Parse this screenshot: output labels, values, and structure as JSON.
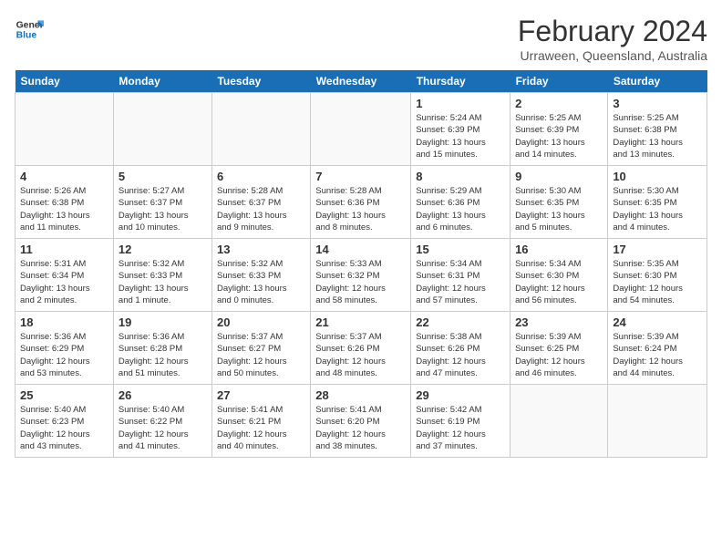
{
  "header": {
    "logo_general": "General",
    "logo_blue": "Blue",
    "month": "February 2024",
    "location": "Urraween, Queensland, Australia"
  },
  "days_of_week": [
    "Sunday",
    "Monday",
    "Tuesday",
    "Wednesday",
    "Thursday",
    "Friday",
    "Saturday"
  ],
  "weeks": [
    [
      {
        "num": "",
        "detail": ""
      },
      {
        "num": "",
        "detail": ""
      },
      {
        "num": "",
        "detail": ""
      },
      {
        "num": "",
        "detail": ""
      },
      {
        "num": "1",
        "detail": "Sunrise: 5:24 AM\nSunset: 6:39 PM\nDaylight: 13 hours\nand 15 minutes."
      },
      {
        "num": "2",
        "detail": "Sunrise: 5:25 AM\nSunset: 6:39 PM\nDaylight: 13 hours\nand 14 minutes."
      },
      {
        "num": "3",
        "detail": "Sunrise: 5:25 AM\nSunset: 6:38 PM\nDaylight: 13 hours\nand 13 minutes."
      }
    ],
    [
      {
        "num": "4",
        "detail": "Sunrise: 5:26 AM\nSunset: 6:38 PM\nDaylight: 13 hours\nand 11 minutes."
      },
      {
        "num": "5",
        "detail": "Sunrise: 5:27 AM\nSunset: 6:37 PM\nDaylight: 13 hours\nand 10 minutes."
      },
      {
        "num": "6",
        "detail": "Sunrise: 5:28 AM\nSunset: 6:37 PM\nDaylight: 13 hours\nand 9 minutes."
      },
      {
        "num": "7",
        "detail": "Sunrise: 5:28 AM\nSunset: 6:36 PM\nDaylight: 13 hours\nand 8 minutes."
      },
      {
        "num": "8",
        "detail": "Sunrise: 5:29 AM\nSunset: 6:36 PM\nDaylight: 13 hours\nand 6 minutes."
      },
      {
        "num": "9",
        "detail": "Sunrise: 5:30 AM\nSunset: 6:35 PM\nDaylight: 13 hours\nand 5 minutes."
      },
      {
        "num": "10",
        "detail": "Sunrise: 5:30 AM\nSunset: 6:35 PM\nDaylight: 13 hours\nand 4 minutes."
      }
    ],
    [
      {
        "num": "11",
        "detail": "Sunrise: 5:31 AM\nSunset: 6:34 PM\nDaylight: 13 hours\nand 2 minutes."
      },
      {
        "num": "12",
        "detail": "Sunrise: 5:32 AM\nSunset: 6:33 PM\nDaylight: 13 hours\nand 1 minute."
      },
      {
        "num": "13",
        "detail": "Sunrise: 5:32 AM\nSunset: 6:33 PM\nDaylight: 13 hours\nand 0 minutes."
      },
      {
        "num": "14",
        "detail": "Sunrise: 5:33 AM\nSunset: 6:32 PM\nDaylight: 12 hours\nand 58 minutes."
      },
      {
        "num": "15",
        "detail": "Sunrise: 5:34 AM\nSunset: 6:31 PM\nDaylight: 12 hours\nand 57 minutes."
      },
      {
        "num": "16",
        "detail": "Sunrise: 5:34 AM\nSunset: 6:30 PM\nDaylight: 12 hours\nand 56 minutes."
      },
      {
        "num": "17",
        "detail": "Sunrise: 5:35 AM\nSunset: 6:30 PM\nDaylight: 12 hours\nand 54 minutes."
      }
    ],
    [
      {
        "num": "18",
        "detail": "Sunrise: 5:36 AM\nSunset: 6:29 PM\nDaylight: 12 hours\nand 53 minutes."
      },
      {
        "num": "19",
        "detail": "Sunrise: 5:36 AM\nSunset: 6:28 PM\nDaylight: 12 hours\nand 51 minutes."
      },
      {
        "num": "20",
        "detail": "Sunrise: 5:37 AM\nSunset: 6:27 PM\nDaylight: 12 hours\nand 50 minutes."
      },
      {
        "num": "21",
        "detail": "Sunrise: 5:37 AM\nSunset: 6:26 PM\nDaylight: 12 hours\nand 48 minutes."
      },
      {
        "num": "22",
        "detail": "Sunrise: 5:38 AM\nSunset: 6:26 PM\nDaylight: 12 hours\nand 47 minutes."
      },
      {
        "num": "23",
        "detail": "Sunrise: 5:39 AM\nSunset: 6:25 PM\nDaylight: 12 hours\nand 46 minutes."
      },
      {
        "num": "24",
        "detail": "Sunrise: 5:39 AM\nSunset: 6:24 PM\nDaylight: 12 hours\nand 44 minutes."
      }
    ],
    [
      {
        "num": "25",
        "detail": "Sunrise: 5:40 AM\nSunset: 6:23 PM\nDaylight: 12 hours\nand 43 minutes."
      },
      {
        "num": "26",
        "detail": "Sunrise: 5:40 AM\nSunset: 6:22 PM\nDaylight: 12 hours\nand 41 minutes."
      },
      {
        "num": "27",
        "detail": "Sunrise: 5:41 AM\nSunset: 6:21 PM\nDaylight: 12 hours\nand 40 minutes."
      },
      {
        "num": "28",
        "detail": "Sunrise: 5:41 AM\nSunset: 6:20 PM\nDaylight: 12 hours\nand 38 minutes."
      },
      {
        "num": "29",
        "detail": "Sunrise: 5:42 AM\nSunset: 6:19 PM\nDaylight: 12 hours\nand 37 minutes."
      },
      {
        "num": "",
        "detail": ""
      },
      {
        "num": "",
        "detail": ""
      }
    ]
  ]
}
